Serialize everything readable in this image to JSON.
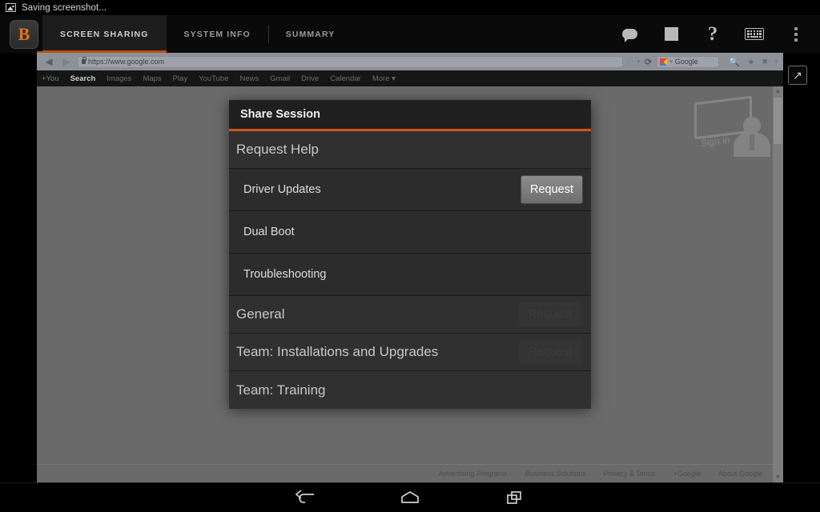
{
  "statusbar": {
    "icon": "image-icon",
    "text": "Saving screenshot..."
  },
  "appbar": {
    "logo_text": "B",
    "tabs": [
      {
        "label": "SCREEN SHARING",
        "active": true
      },
      {
        "label": "SYSTEM INFO",
        "active": false
      },
      {
        "label": "SUMMARY",
        "active": false
      }
    ],
    "actions": [
      {
        "name": "chat-icon",
        "label": "Chat"
      },
      {
        "name": "stop-icon",
        "label": "Stop"
      },
      {
        "name": "help-icon",
        "label": "?"
      },
      {
        "name": "keyboard-icon",
        "label": "Keyboard"
      },
      {
        "name": "overflow-menu-icon",
        "label": "More options"
      }
    ],
    "accent_color": "#c1490f"
  },
  "remote_screen": {
    "browser": {
      "back_glyph": "◀",
      "forward_glyph": "▶",
      "url": "https://www.google.com",
      "secure": true,
      "star_glyph": "☆",
      "caret_glyph": "▾",
      "reload_glyph": "⟳",
      "search_engine": "Google",
      "right_icons": [
        "search-icon",
        "star-icon",
        "settings-icon"
      ]
    },
    "google_nav": [
      {
        "label": "+You",
        "bold": false
      },
      {
        "label": "Search",
        "bold": true
      },
      {
        "label": "Images",
        "bold": false
      },
      {
        "label": "Maps",
        "bold": false
      },
      {
        "label": "Play",
        "bold": false
      },
      {
        "label": "YouTube",
        "bold": false
      },
      {
        "label": "News",
        "bold": false
      },
      {
        "label": "Gmail",
        "bold": false
      },
      {
        "label": "Drive",
        "bold": false
      },
      {
        "label": "Calendar",
        "bold": false
      },
      {
        "label": "More ▾",
        "bold": false
      }
    ],
    "google_footer": [
      "Advertising Programs",
      "Business Solutions",
      "Privacy & Terms",
      "+Google",
      "About Google"
    ],
    "watermark_text": "Sign in",
    "expand_glyph": "↗"
  },
  "dialog": {
    "title": "Share Session",
    "accent_color": "#d2561a",
    "sections": [
      {
        "name": "request-help",
        "label": "Request Help",
        "rows": [
          {
            "label": "Driver Updates",
            "button": "Request",
            "button_enabled": true
          },
          {
            "label": "Dual Boot",
            "button": "",
            "button_enabled": false
          },
          {
            "label": "Troubleshooting",
            "button": "",
            "button_enabled": false
          }
        ]
      },
      {
        "name": "general",
        "label": "General",
        "ghost_button": "Request"
      },
      {
        "name": "team-installations-and-upgrades",
        "label": "Team: Installations and Upgrades",
        "ghost_button": "Request"
      },
      {
        "name": "team-training",
        "label": "Team: Training",
        "ghost_button": ""
      }
    ]
  },
  "navbar": {
    "back": "back-icon",
    "home": "home-icon",
    "recents": "recents-icon"
  }
}
